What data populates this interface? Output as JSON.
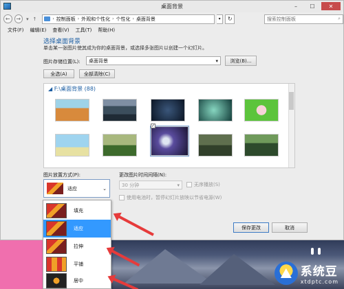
{
  "window": {
    "title": "桌面背景"
  },
  "address": {
    "crumbs": [
      "控制面板",
      "外观和个性化",
      "个性化",
      "桌面背景"
    ],
    "search_placeholder": "搜索控制面板"
  },
  "menu": [
    "文件(F)",
    "编辑(E)",
    "查看(V)",
    "工具(T)",
    "帮助(H)"
  ],
  "main": {
    "heading": "选择桌面背景",
    "description": "单击某一张图片使其成为你的桌面背景，或选择多张图片以创建一个幻灯片。",
    "location_label": "图片存储位置(L):",
    "location_value": "桌面背景",
    "browse_label": "浏览(B)...",
    "select_all_label": "全选(A)",
    "clear_all_label": "全部清除(C)",
    "gallery_header": "F:\\桌面背景 (88)"
  },
  "position": {
    "label": "图片放置方式(P):",
    "selected": "适应",
    "options": [
      "填充",
      "适应",
      "拉伸",
      "平铺",
      "居中"
    ]
  },
  "interval": {
    "label": "更改图片时间间隔(N):",
    "value": "30 分钟",
    "shuffle_label": "无序播放(S)",
    "battery_label": "使用电池时，暂停幻灯片放映以节省电源(W)"
  },
  "buttons": {
    "save": "保存更改",
    "cancel": "取消"
  },
  "watermark": {
    "cn": "系统豆",
    "en": "xtdptc.com"
  }
}
